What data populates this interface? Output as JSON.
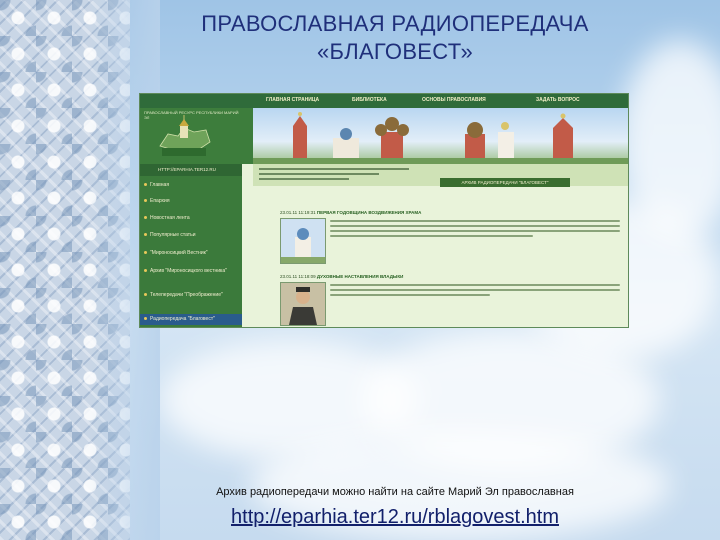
{
  "slide": {
    "title_line1": "ПРАВОСЛАВНАЯ РАДИОПЕРЕДАЧА",
    "title_line2": "«БЛАГОВЕСТ»",
    "caption": "Архив радиопередачи можно найти на сайте Марий Эл православная",
    "link": "http://eparhia.ter12.ru/rblagovest.htm"
  },
  "website": {
    "nav": [
      "ГЛАВНАЯ СТРАНИЦА",
      "БИБЛИОТЕКА",
      "ОСНОВЫ ПРАВОСЛАВИЯ",
      "ЗАДАТЬ ВОПРОС"
    ],
    "logo_caption": "ПРАВОСЛАВНЫЙ РЕСУРС РЕСПУБЛИКИ МАРИЙ ЭЛ",
    "url": "HTTP://EPARHIA.TER12.RU",
    "sidebar": [
      "Главная",
      "Епархия",
      "Новостная лента",
      "Популярные статьи",
      "\"Мироносицкий Вестник\"",
      "Архив \"Мироносицкого вестника\"",
      "Телепередачи \"Преображение\"",
      "Радиопередача \"Благовест\""
    ],
    "archive_label": "АРХИВ РАДИОПЕРЕДАЧИ \"БЛАГОВЕСТ\"",
    "news": [
      {
        "date": "23.01.11 11:19:31",
        "title": "ПЕРВАЯ ГОДОВЩИНА ВОЗДВИЖЕНИЯ ХРАМА"
      },
      {
        "date": "23.01.11 11:18:09",
        "title": "ДУХОВНЫЕ НАСТАВЛЕНИЯ ВЛАДЫКИ"
      }
    ]
  },
  "colors": {
    "title": "#1f2f7a",
    "site_green": "#3d7d3c",
    "link": "#12206b"
  }
}
